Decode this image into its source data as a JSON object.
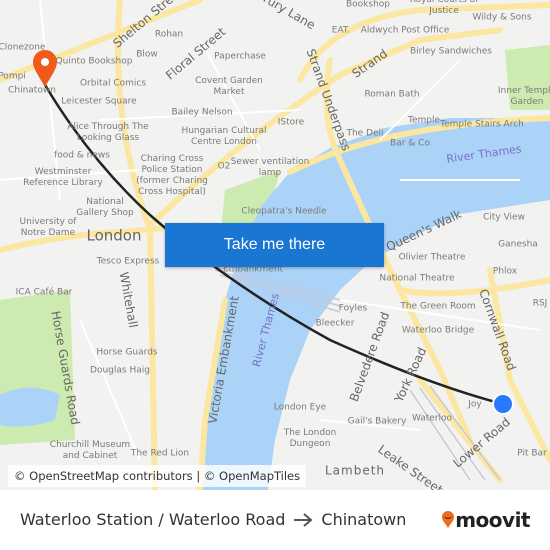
{
  "map": {
    "labels": [
      "Clonezone",
      "Quinto Bookshop",
      "Pompi",
      "Chinatown",
      "Orbital Comics",
      "Leicester Square",
      "Alice Through The Looking Glass",
      "food & news",
      "Westminster Reference Library",
      "National Gallery Shop",
      "University of Notre Dame",
      "London",
      "Tesco Express",
      "ICA Café Bar",
      "Horse Guards",
      "Douglas Haig",
      "Churchill Museum and Cabinet",
      "The Red Lion",
      "Rohan",
      "Blow",
      "Floral Street",
      "Shelton Street",
      "Paperchase",
      "Covent Garden Market",
      "Bailey Nelson",
      "Hungarian Cultural Centre London",
      "Charing Cross Police Station (former Charing Cross Hospital)",
      "O2",
      "Sewer ventilation lamp",
      "Cleopatra's Needle",
      "Embankment",
      "Bookshop",
      "Royal Courts of Justice",
      "Wildy & Sons",
      "EAT.",
      "Aldwych Post Office",
      "Birley Sandwiches",
      "Strand",
      "Strand Underpass",
      "Roman Bath",
      "IStore",
      "The Deli",
      "Temple",
      "Temple Stairs Arch",
      "Inner Temple Garden",
      "Bar & Co",
      "River Thames",
      "Queen's Walk",
      "City View",
      "Ganesha",
      "Olivier Theatre",
      "National Theatre",
      "Phlox",
      "The Green Room",
      "Foyles",
      "Bleecker",
      "Waterloo Bridge",
      "Cornwall Road",
      "RSJ",
      "Belvedere Road",
      "York Road",
      "River Thames",
      "Victoria Embankment",
      "Whitehall",
      "Horse Guards Road",
      "London Eye",
      "The London Dungeon",
      "Gail's Bakery",
      "Waterloo",
      "Joy",
      "Lower Road",
      "Leake Street",
      "Lambeth",
      "Pit Bar",
      "Drury Lane"
    ],
    "attribution": "© OpenStreetMap contributors | © OpenMapTiles",
    "cta_label": "Take me there",
    "origin_icon": "blue-dot-icon",
    "destination_icon": "map-pin-icon",
    "colors": {
      "water": "#aad3f7",
      "road": "#fbe7a1",
      "land": "#f2f2f0",
      "park": "#cdebb0",
      "route": "#222222",
      "pin": "#f05a1a",
      "dot": "#2979ff",
      "button": "#1976d2"
    }
  },
  "footer": {
    "origin": "Waterloo Station / Waterloo Road",
    "arrow_icon": "arrow-right-icon",
    "destination": "Chinatown",
    "brand": "moovit"
  }
}
